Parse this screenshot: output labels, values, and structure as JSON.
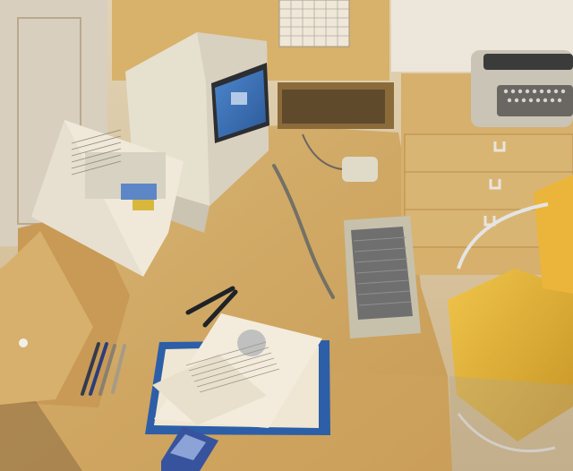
{
  "scene": {
    "alt_names": {
      "photo": "office-desk-photo",
      "computer": "compact-computer",
      "keyboard": "keyboard",
      "mouse": "mouse",
      "typewriter": "typewriter",
      "chair": "yellow-chair",
      "book": "open-book",
      "papers": "paper-stack",
      "pens": "pens",
      "wall_chart": "wall-calendar"
    },
    "colors": {
      "desk": "#d5b06a",
      "desk_shadow": "#a77c3a",
      "wall": "#d9c8a5",
      "cabinet": "#cfa867",
      "chair": "#e0b437",
      "chair_frame": "#d8d8d8",
      "computer": "#e6e0cf",
      "screen": "#3f74b9",
      "keyboard": "#c7c1ac",
      "keys": "#6f6f6f",
      "typewriter": "#c8c3b2",
      "folder_blue": "#2d5ea8",
      "paper": "#efe7d3"
    }
  }
}
